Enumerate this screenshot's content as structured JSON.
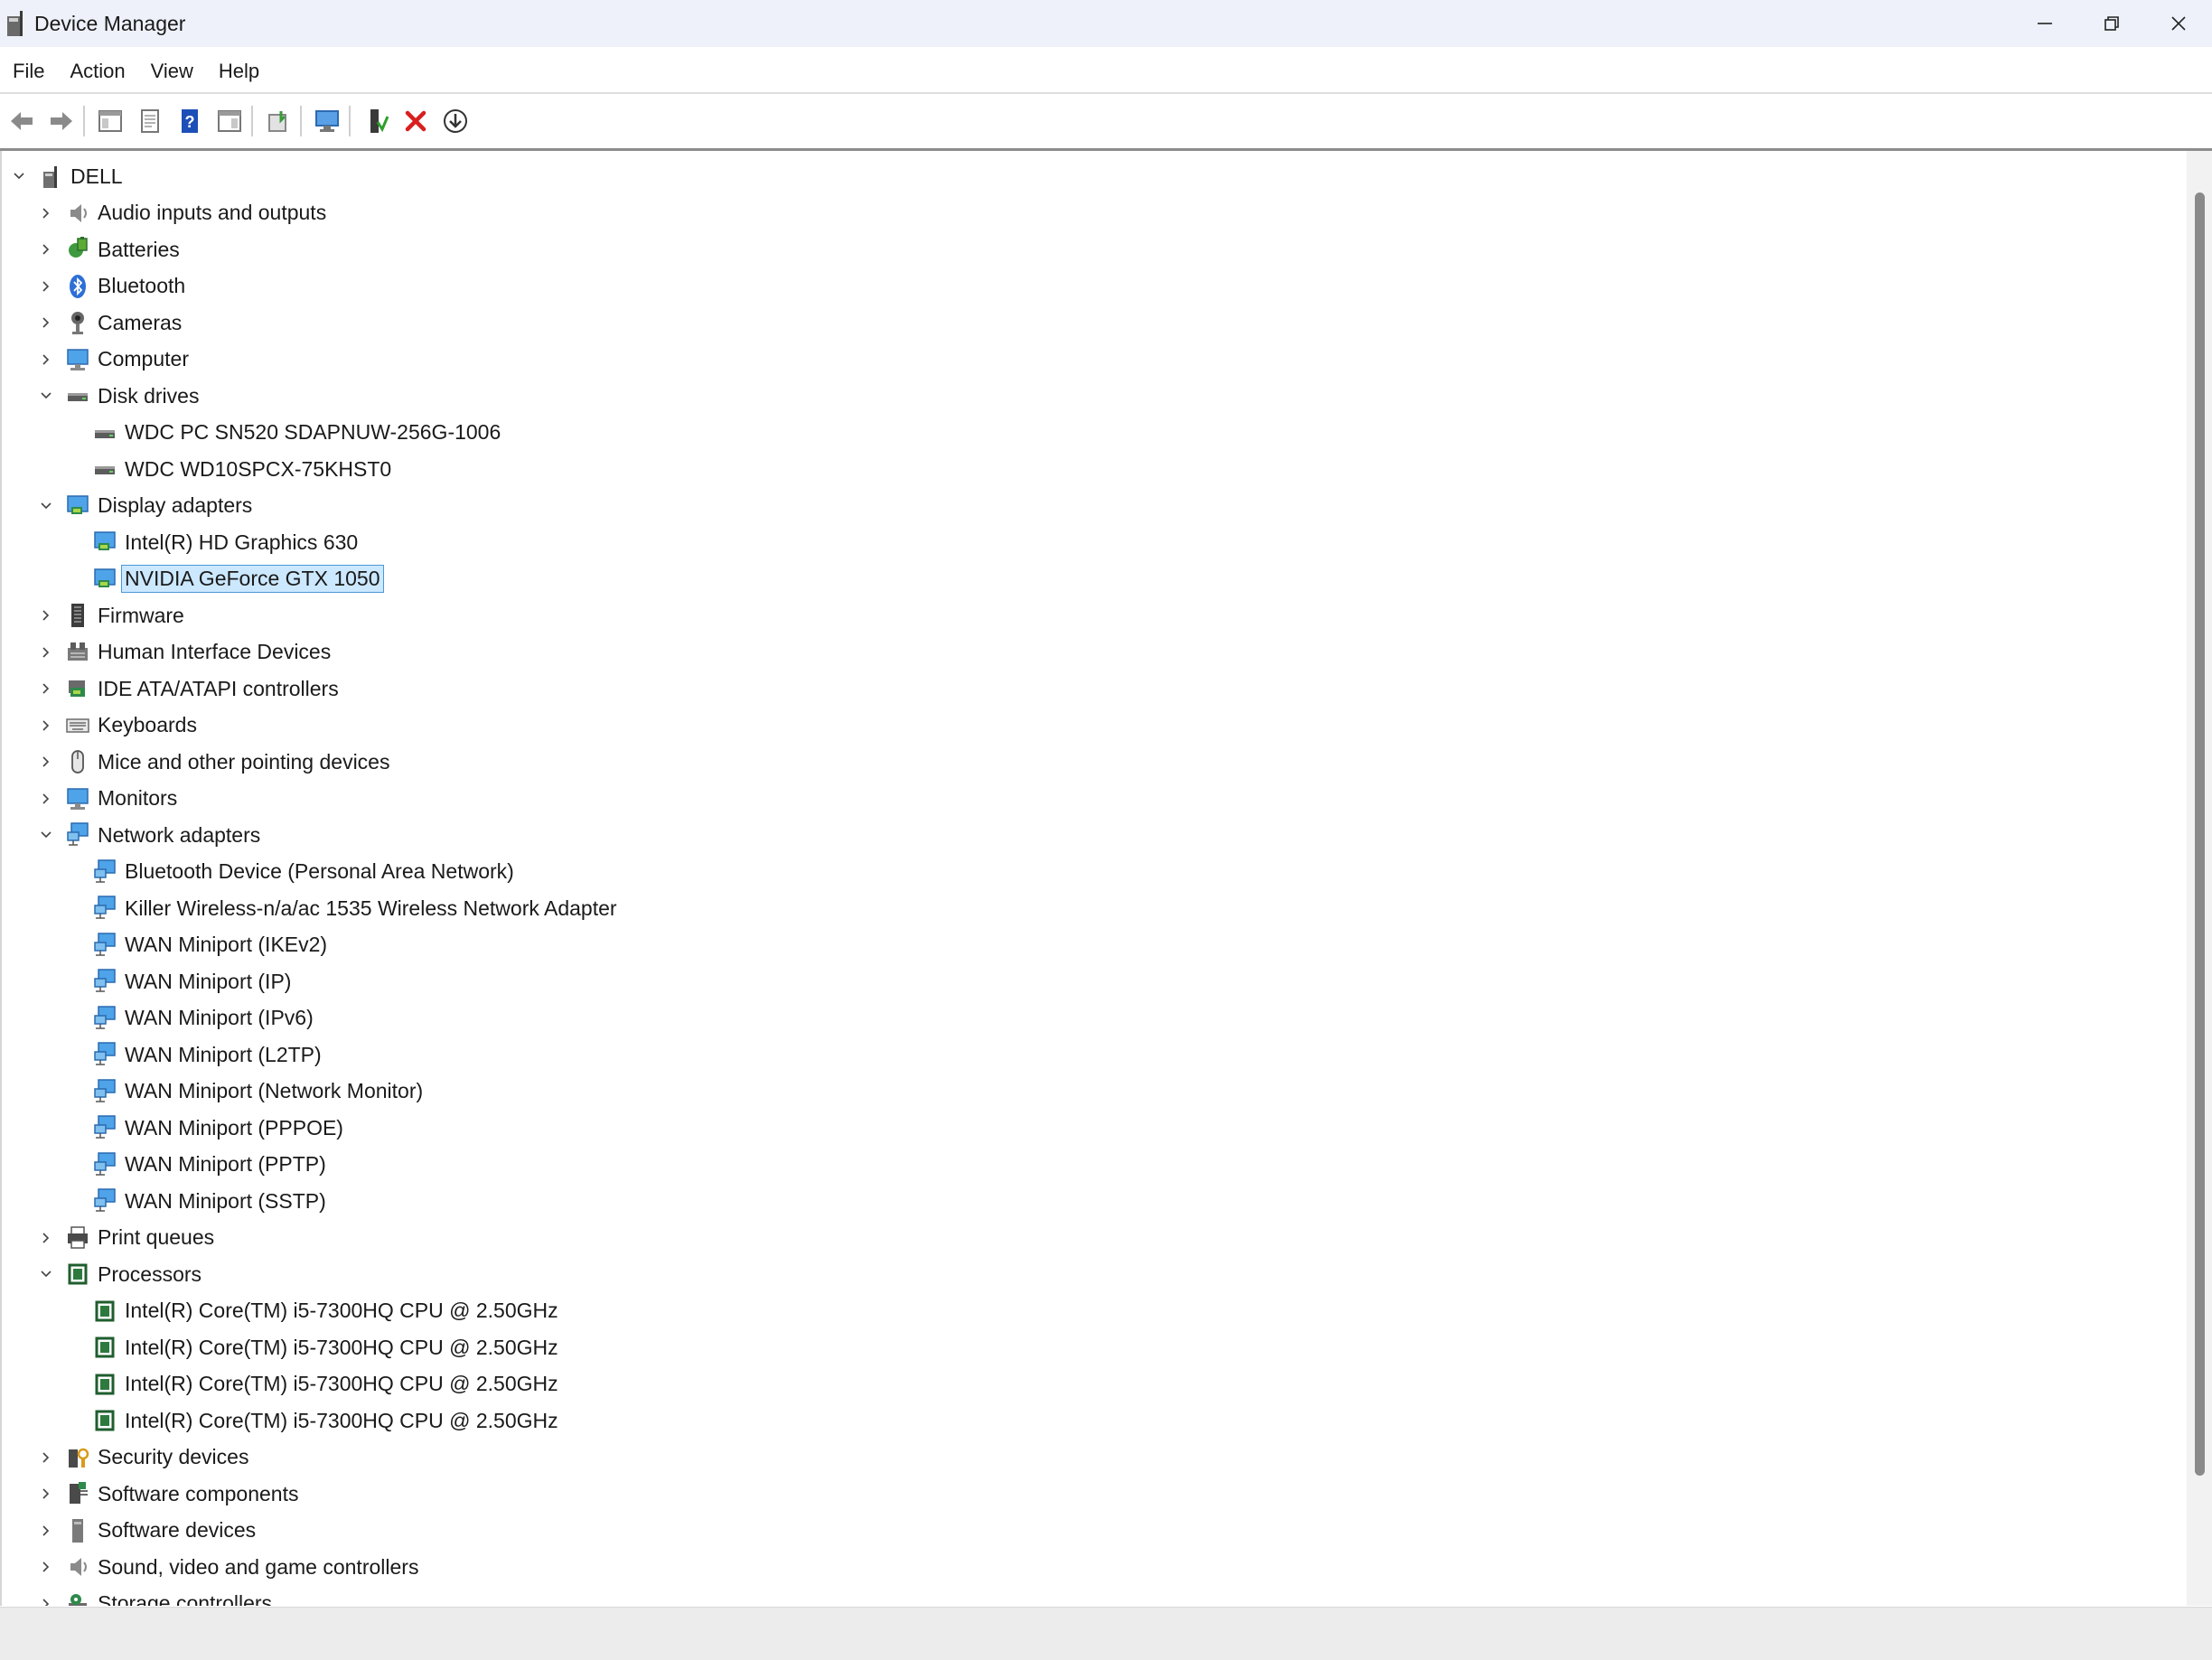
{
  "window": {
    "title": "Device Manager"
  },
  "menu": [
    "File",
    "Action",
    "View",
    "Help"
  ],
  "toolbar": {
    "icons": [
      "back-arrow-icon",
      "forward-arrow-icon",
      "show-hide-console-tree-icon",
      "properties-icon",
      "help-icon",
      "action-pane-icon",
      "update-driver-icon",
      "scan-hardware-icon",
      "enable-device-icon",
      "uninstall-device-icon",
      "download-driver-icon"
    ]
  },
  "tree": {
    "root": "DELL",
    "categories": [
      {
        "label": "Audio inputs and outputs",
        "icon": "speaker-icon",
        "expanded": false,
        "children": []
      },
      {
        "label": "Batteries",
        "icon": "battery-icon",
        "expanded": false,
        "children": []
      },
      {
        "label": "Bluetooth",
        "icon": "bluetooth-icon",
        "expanded": false,
        "children": []
      },
      {
        "label": "Cameras",
        "icon": "camera-icon",
        "expanded": false,
        "children": []
      },
      {
        "label": "Computer",
        "icon": "monitor-icon",
        "expanded": false,
        "children": []
      },
      {
        "label": "Disk drives",
        "icon": "disk-drive-icon",
        "expanded": true,
        "children": [
          "WDC PC SN520 SDAPNUW-256G-1006",
          "WDC WD10SPCX-75KHST0"
        ]
      },
      {
        "label": "Display adapters",
        "icon": "display-adapter-icon",
        "expanded": true,
        "children": [
          "Intel(R) HD Graphics 630",
          "NVIDIA GeForce GTX 1050"
        ]
      },
      {
        "label": "Firmware",
        "icon": "firmware-icon",
        "expanded": false,
        "children": []
      },
      {
        "label": "Human Interface Devices",
        "icon": "hid-icon",
        "expanded": false,
        "children": []
      },
      {
        "label": "IDE ATA/ATAPI controllers",
        "icon": "ide-controller-icon",
        "expanded": false,
        "children": []
      },
      {
        "label": "Keyboards",
        "icon": "keyboard-icon",
        "expanded": false,
        "children": []
      },
      {
        "label": "Mice and other pointing devices",
        "icon": "mouse-icon",
        "expanded": false,
        "children": []
      },
      {
        "label": "Monitors",
        "icon": "monitor-icon",
        "expanded": false,
        "children": []
      },
      {
        "label": "Network adapters",
        "icon": "network-adapter-icon",
        "expanded": true,
        "children": [
          "Bluetooth Device (Personal Area Network)",
          "Killer Wireless-n/a/ac 1535 Wireless Network Adapter",
          "WAN Miniport (IKEv2)",
          "WAN Miniport (IP)",
          "WAN Miniport (IPv6)",
          "WAN Miniport (L2TP)",
          "WAN Miniport (Network Monitor)",
          "WAN Miniport (PPPOE)",
          "WAN Miniport (PPTP)",
          "WAN Miniport (SSTP)"
        ]
      },
      {
        "label": "Print queues",
        "icon": "printer-icon",
        "expanded": false,
        "children": []
      },
      {
        "label": "Processors",
        "icon": "processor-icon",
        "expanded": true,
        "children": [
          "Intel(R) Core(TM) i5-7300HQ CPU @ 2.50GHz",
          "Intel(R) Core(TM) i5-7300HQ CPU @ 2.50GHz",
          "Intel(R) Core(TM) i5-7300HQ CPU @ 2.50GHz",
          "Intel(R) Core(TM) i5-7300HQ CPU @ 2.50GHz"
        ]
      },
      {
        "label": "Security devices",
        "icon": "security-device-icon",
        "expanded": false,
        "children": []
      },
      {
        "label": "Software components",
        "icon": "software-component-icon",
        "expanded": false,
        "children": []
      },
      {
        "label": "Software devices",
        "icon": "software-device-icon",
        "expanded": false,
        "children": []
      },
      {
        "label": "Sound, video and game controllers",
        "icon": "speaker-icon",
        "expanded": false,
        "children": []
      },
      {
        "label": "Storage controllers",
        "icon": "storage-controller-icon",
        "expanded": false,
        "children": []
      }
    ],
    "selected": "NVIDIA GeForce GTX 1050"
  }
}
